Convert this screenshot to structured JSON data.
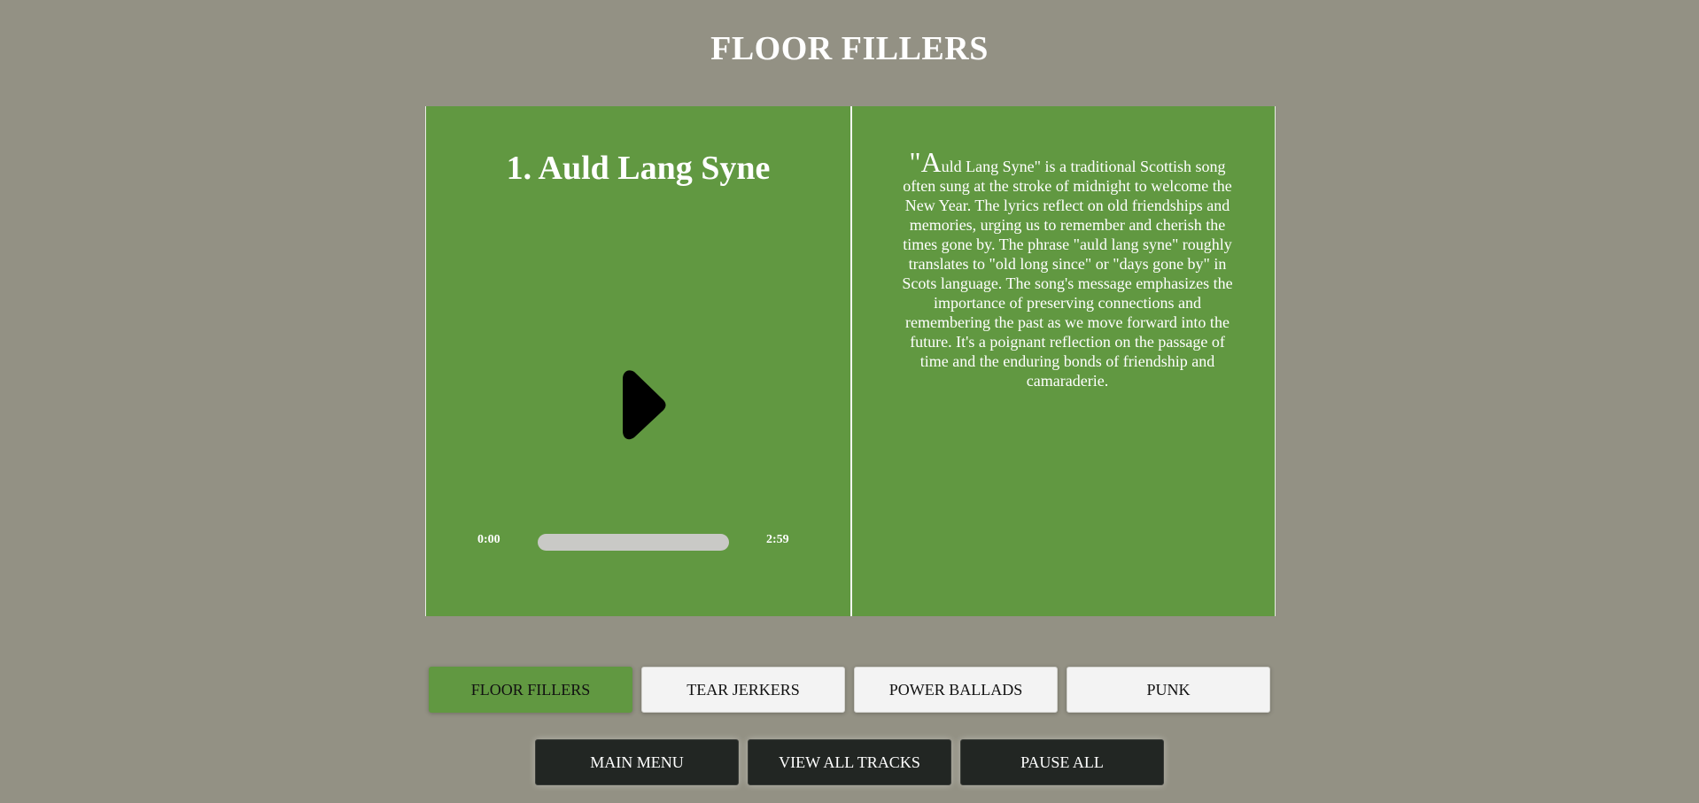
{
  "page": {
    "title": "FLOOR FILLERS"
  },
  "player": {
    "track_title": "1. Auld Lang Syne",
    "current_time": "0:00",
    "total_time": "2:59",
    "progress": 0,
    "play_icon": "play-icon"
  },
  "description": {
    "quote_mark": "\"",
    "dropcap": "A",
    "text": "uld Lang Syne\" is a traditional Scottish song often sung at the stroke of midnight to welcome the New Year. The lyrics reflect on old friendships and memories, urging us to remember and cherish the times gone by. The phrase \"auld lang syne\" roughly translates to \"old long since\" or \"days gone by\" in Scots language. The song's message emphasizes the importance of preserving connections and remembering the past as we move forward into the future. It's a poignant reflection on the passage of time and the enduring bonds of friendship and camaraderie."
  },
  "tabs": [
    {
      "label": "FLOOR FILLERS",
      "active": true
    },
    {
      "label": "TEAR JERKERS",
      "active": false
    },
    {
      "label": "POWER BALLADS",
      "active": false
    },
    {
      "label": "PUNK",
      "active": false
    }
  ],
  "actions": {
    "main_menu": "MAIN MENU",
    "view_all_tracks": "VIEW ALL TRACKS",
    "pause_all": "PAUSE ALL"
  },
  "colors": {
    "background": "#939184",
    "card": "#619841",
    "active_tab": "#619841",
    "action_button": "#222623",
    "text_light": "#ffffff"
  }
}
